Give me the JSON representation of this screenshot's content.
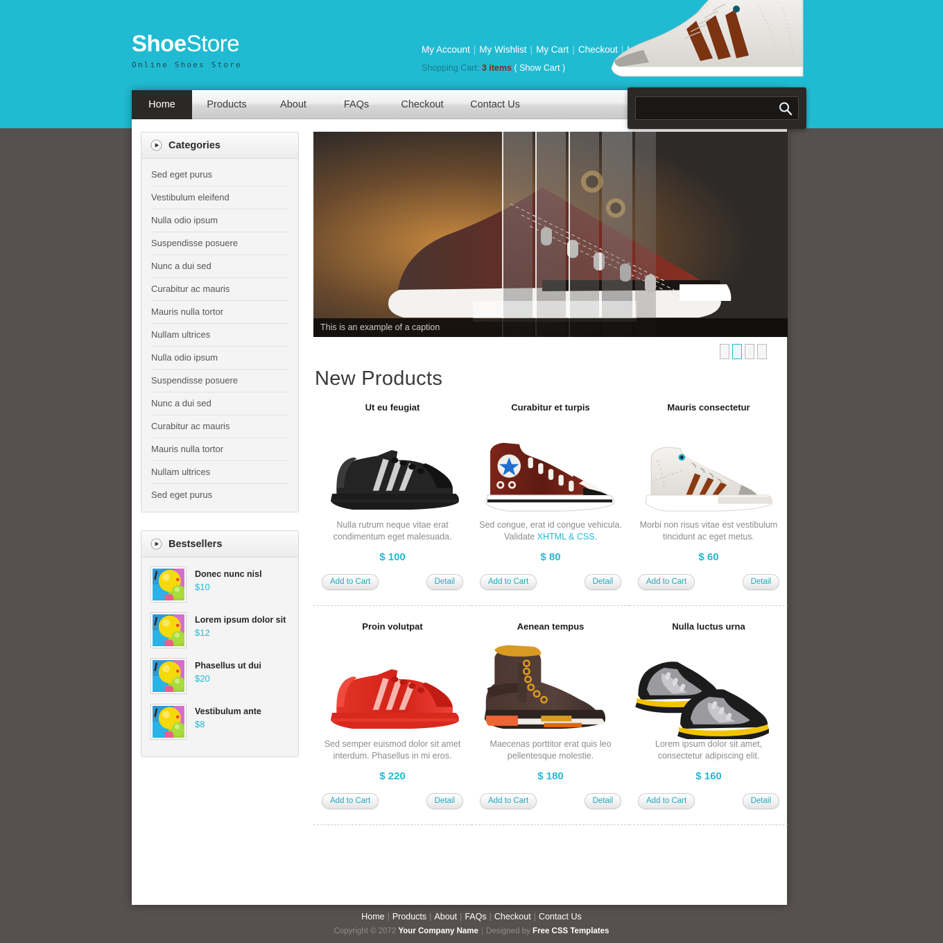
{
  "header": {
    "logo_bold": "Shoe",
    "logo_light": "Store",
    "tagline": "Online Shoes Store",
    "account_links": [
      "My Account",
      "My Wishlist",
      "My Cart",
      "Checkout",
      "Log In"
    ],
    "cart_label": "Shopping Cart:",
    "cart_items": "3 items",
    "cart_open_paren": "(",
    "cart_show": "Show Cart",
    "cart_close_paren": ")",
    "shoe_icon": "hightop-sneaker-icon"
  },
  "nav": {
    "items": [
      {
        "label": "Home",
        "active": true
      },
      {
        "label": "Products",
        "active": false
      },
      {
        "label": "About",
        "active": false
      },
      {
        "label": "FAQs",
        "active": false
      },
      {
        "label": "Checkout",
        "active": false
      },
      {
        "label": "Contact Us",
        "active": false
      }
    ],
    "search_placeholder": "",
    "search_value": "",
    "search_icon": "magnifier-icon"
  },
  "sidebar": {
    "categories": {
      "title": "Categories",
      "arrow_icon": "play-arrow-icon",
      "items": [
        "Sed eget purus",
        "Vestibulum eleifend",
        "Nulla odio ipsum",
        "Suspendisse posuere",
        "Nunc a dui sed",
        "Curabitur ac mauris",
        "Mauris nulla tortor",
        "Nullam ultrices",
        "Nulla odio ipsum",
        "Suspendisse posuere",
        "Nunc a dui sed",
        "Curabitur ac mauris",
        "Mauris nulla tortor",
        "Nullam ultrices",
        "Sed eget purus"
      ]
    },
    "bestsellers": {
      "title": "Bestsellers",
      "arrow_icon": "play-arrow-icon",
      "items": [
        {
          "name": "Donec nunc nisl",
          "price": "$10",
          "thumb": "balloons-thumb"
        },
        {
          "name": "Lorem ipsum dolor sit",
          "price": "$12",
          "thumb": "balloons-thumb"
        },
        {
          "name": "Phasellus ut dui",
          "price": "$20",
          "thumb": "balloons-thumb"
        },
        {
          "name": "Vestibulum ante",
          "price": "$8",
          "thumb": "balloons-thumb"
        }
      ]
    }
  },
  "banner": {
    "caption": "This is an example of a caption",
    "image": "dark-red-sneaker-banner",
    "pager_count": 4,
    "pager_active_index": 1
  },
  "main": {
    "section_title": "New Products",
    "products": [
      {
        "name": "Ut eu feugiat",
        "image": "black-sneaker",
        "desc": "Nulla rutrum neque vitae erat condimentum eget malesuada.",
        "desc_link": "",
        "price": "$ 100",
        "add_label": "Add to Cart",
        "detail_label": "Detail"
      },
      {
        "name": "Curabitur et turpis",
        "image": "maroon-hightop-star-sneaker",
        "desc": "Sed congue, erat id congue vehicula. Validate ",
        "desc_link": "XHTML & CSS.",
        "price": "$ 80",
        "add_label": "Add to Cart",
        "detail_label": "Detail"
      },
      {
        "name": "Mauris consectetur",
        "image": "cream-hightop-sneaker",
        "desc": "Morbi non risus vitae est vestibulum tincidunt ac eget metus.",
        "desc_link": "",
        "price": "$ 60",
        "add_label": "Add to Cart",
        "detail_label": "Detail"
      },
      {
        "name": "Proin volutpat",
        "image": "red-sneaker",
        "desc": "Sed semper euismod dolor sit amet interdum. Phasellus in mi eros.",
        "desc_link": "",
        "price": "$ 220",
        "add_label": "Add to Cart",
        "detail_label": "Detail"
      },
      {
        "name": "Aenean tempus",
        "image": "brown-leather-boot",
        "desc": "Maecenas porttitor erat quis leo pellentesque molestie.",
        "desc_link": "",
        "price": "$ 180",
        "add_label": "Add to Cart",
        "detail_label": "Detail"
      },
      {
        "name": "Nulla luctus urna",
        "image": "grey-yellow-sneaker-pair",
        "desc": "Lorem ipsum dolor sit amet, consectetur adipiscing elit.",
        "desc_link": "",
        "price": "$ 160",
        "add_label": "Add to Cart",
        "detail_label": "Detail"
      }
    ]
  },
  "footer": {
    "links": [
      "Home",
      "Products",
      "About",
      "FAQs",
      "Checkout",
      "Contact Us"
    ],
    "copyright_prefix": "Copyright © 2072",
    "company": "Your Company Name",
    "designed_prefix": "Designed by",
    "designer": "Free CSS Templates"
  },
  "colors": {
    "teal": "#20bbd2",
    "page_bg": "#56504f",
    "nav_active": "#2b2927",
    "price": "#20bbd2"
  }
}
